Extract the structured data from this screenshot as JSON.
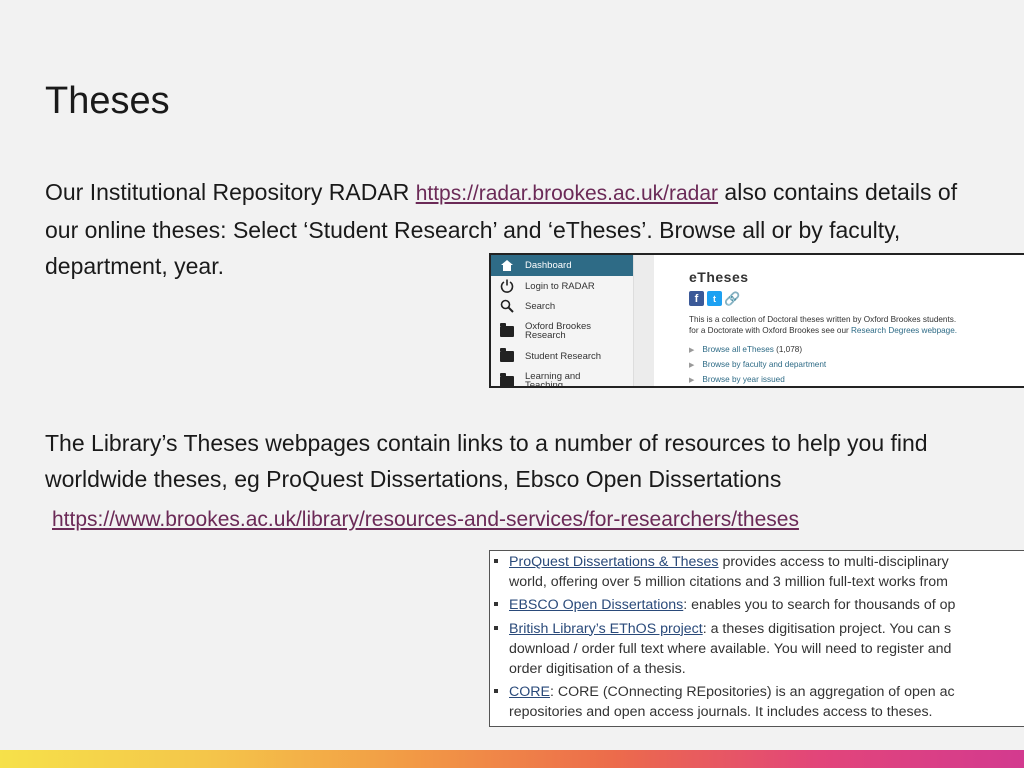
{
  "title": "Theses",
  "para1": {
    "text_before": "Our Institutional Repository RADAR ",
    "link": "https://radar.brookes.ac.uk/radar",
    "text_after": " also contains details of our online theses: Select ‘Student Research’ and ‘eTheses’. Browse all or by faculty, department, year."
  },
  "radar": {
    "sidebar": [
      {
        "label": "Dashboard",
        "icon": "home-icon",
        "active": true
      },
      {
        "label": "Login to RADAR",
        "icon": "power-icon"
      },
      {
        "label": "Search",
        "icon": "search-icon"
      },
      {
        "label": "Oxford Brookes Research",
        "icon": "folder-icon"
      },
      {
        "label": "Student Research",
        "icon": "folder-icon"
      },
      {
        "label": "Learning and Teaching",
        "icon": "folder-icon"
      }
    ],
    "heading": "eTheses",
    "desc_line1": "This is a collection of Doctoral theses written by Oxford Brookes students.",
    "desc_line2": "for a Doctorate with Oxford Brookes see our ",
    "desc_link": "Research Degrees webpage.",
    "browse": [
      {
        "label": "Browse all eTheses",
        "count": "(1,078)"
      },
      {
        "label": "Browse by faculty and department"
      },
      {
        "label": "Browse by year issued"
      }
    ]
  },
  "para2": {
    "text": "The Library’s Theses webpages contain links to a number of resources to help you find worldwide theses, eg ProQuest Dissertations, Ebsco Open Dissertations"
  },
  "url2": "https://www.brookes.ac.uk/library/resources-and-services/for-researchers/theses",
  "resources": [
    {
      "link": "ProQuest Dissertations & Theses",
      "text": " provides access to multi-disciplinary",
      "extra": [
        "world, offering over 5 million citations and 3 million full-text works from"
      ]
    },
    {
      "link": "EBSCO Open Dissertations",
      "text": ": enables you to search for thousands of op",
      "extra": []
    },
    {
      "link": "British Library’s EThOS project",
      "text": ": a theses digitisation project. You can s",
      "extra": [
        "download / order full text where available. You will need to register and",
        "order digitisation of a thesis."
      ]
    },
    {
      "link": "CORE",
      "text": ": CORE (COnnecting REpositories) is an aggregation of open ac",
      "extra": [
        "repositories and open access journals. It includes access to theses."
      ]
    }
  ],
  "colors": {
    "link": "#6b2a57",
    "radar_accent": "#2e6b86"
  }
}
